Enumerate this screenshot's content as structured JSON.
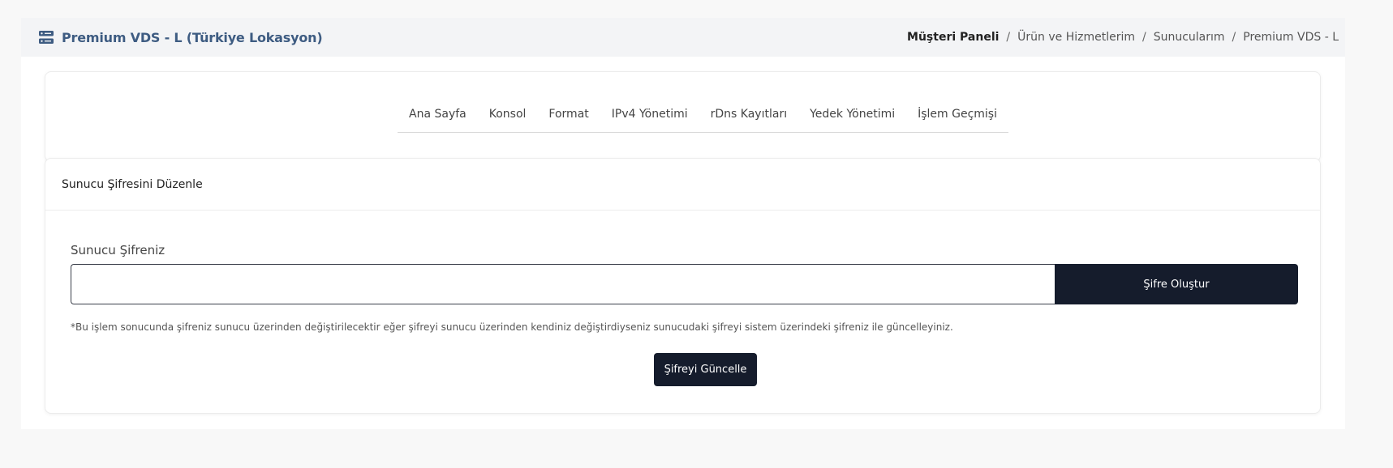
{
  "header": {
    "title": "Premium VDS - L (Türkiye Lokasyon)",
    "icon": "server-icon",
    "accent_color": "#3e5c82"
  },
  "breadcrumb": {
    "items": [
      "Müşteri Paneli",
      "Ürün ve Hizmetlerim",
      "Sunucularım",
      "Premium VDS - L"
    ],
    "separator": "/"
  },
  "tabs": {
    "items": [
      "Ana Sayfa",
      "Konsol",
      "Format",
      "IPv4 Yönetimi",
      "rDns Kayıtları",
      "Yedek Yönetimi",
      "İşlem Geçmişi"
    ]
  },
  "form": {
    "title": "Sunucu Şifresini Düzenle",
    "password_label": "Sunucu Şifreniz",
    "password_value": "",
    "generate_button": "Şifre Oluştur",
    "note": "*Bu işlem sonucunda şifreniz sunucu üzerinden değiştirilecektir eğer şifreyi sunucu üzerinden kendiniz değiştirdiyseniz sunucudaki şifreyi sistem üzerindeki şifreniz ile güncelleyiniz.",
    "update_button": "Şifreyi Güncelle",
    "button_color": "#151c2c"
  }
}
